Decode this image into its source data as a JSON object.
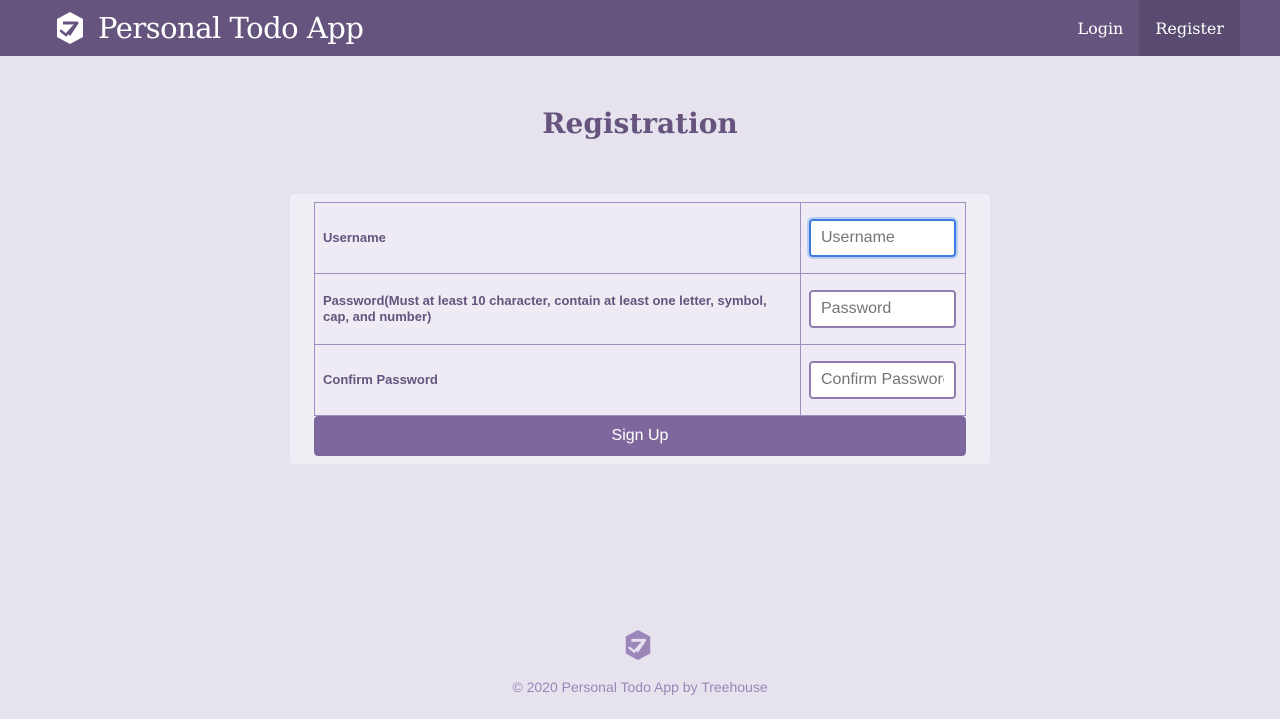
{
  "brand": {
    "logo_icon": "todo-logo-icon",
    "title": "Personal Todo App"
  },
  "nav": {
    "login_label": "Login",
    "register_label": "Register",
    "active": "Register"
  },
  "page": {
    "title": "Registration"
  },
  "form": {
    "username": {
      "label": "Username",
      "placeholder": "Username",
      "value": ""
    },
    "password": {
      "label": "Password(Must at least 10 character, contain at least one letter, symbol, cap, and number)",
      "placeholder": "Password",
      "value": ""
    },
    "confirm_password": {
      "label": "Confirm Password",
      "placeholder": "Confirm Password",
      "value": ""
    },
    "submit_label": "Sign Up"
  },
  "footer": {
    "logo_icon": "todo-logo-icon",
    "copyright": "© 2020 Personal Todo App by Treehouse"
  },
  "colors": {
    "primary": "#65547e",
    "button": "#7e679d",
    "background": "#e6e3ee",
    "focus": "#3f7ce0"
  }
}
